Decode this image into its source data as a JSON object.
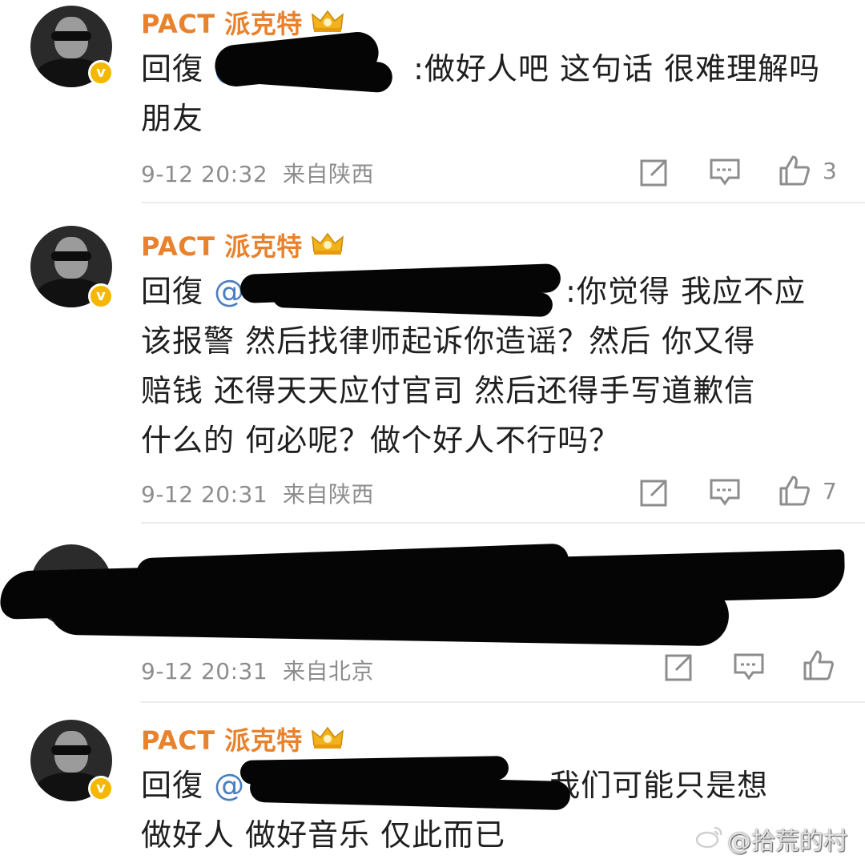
{
  "comments": [
    {
      "username": "PACT 派克特",
      "reply_prefix": "回復",
      "mention": "@",
      "line1_tail": ":做好人吧 这句话 很难理解吗",
      "line2": "朋友",
      "timestamp": "9-12 20:32",
      "location": "来自陕西",
      "like_count": "3"
    },
    {
      "username": "PACT 派克特",
      "reply_prefix": "回復",
      "mention": "@",
      "line1_tail": ":你觉得 我应不应",
      "line2": "该报警 然后找律师起诉你造谣？然后 你又得",
      "line3": "赔钱 还得天天应付官司 然后还得手写道歉信",
      "line4": "什么的 何必呢？做个好人不行吗？",
      "timestamp": "9-12 20:31",
      "location": "来自陕西",
      "like_count": "7"
    },
    {
      "username": "",
      "timestamp": "9-12 20:31",
      "location": "来自北京",
      "like_count": ""
    },
    {
      "username": "PACT 派克特",
      "reply_prefix": "回復",
      "mention": "@",
      "line1_tail": "我们可能只是想",
      "line2": "做好人 做好音乐 仅此而已"
    }
  ],
  "watermark": "@拾荒的村姑",
  "colors": {
    "username": "#e8822d",
    "mention": "#4a7fc0",
    "meta": "#8d8d8d",
    "verified": "#f5b700"
  },
  "icons": [
    "share-icon",
    "comment-icon",
    "like-icon",
    "verified-icon",
    "crown-icon",
    "weibo-logo-icon"
  ]
}
